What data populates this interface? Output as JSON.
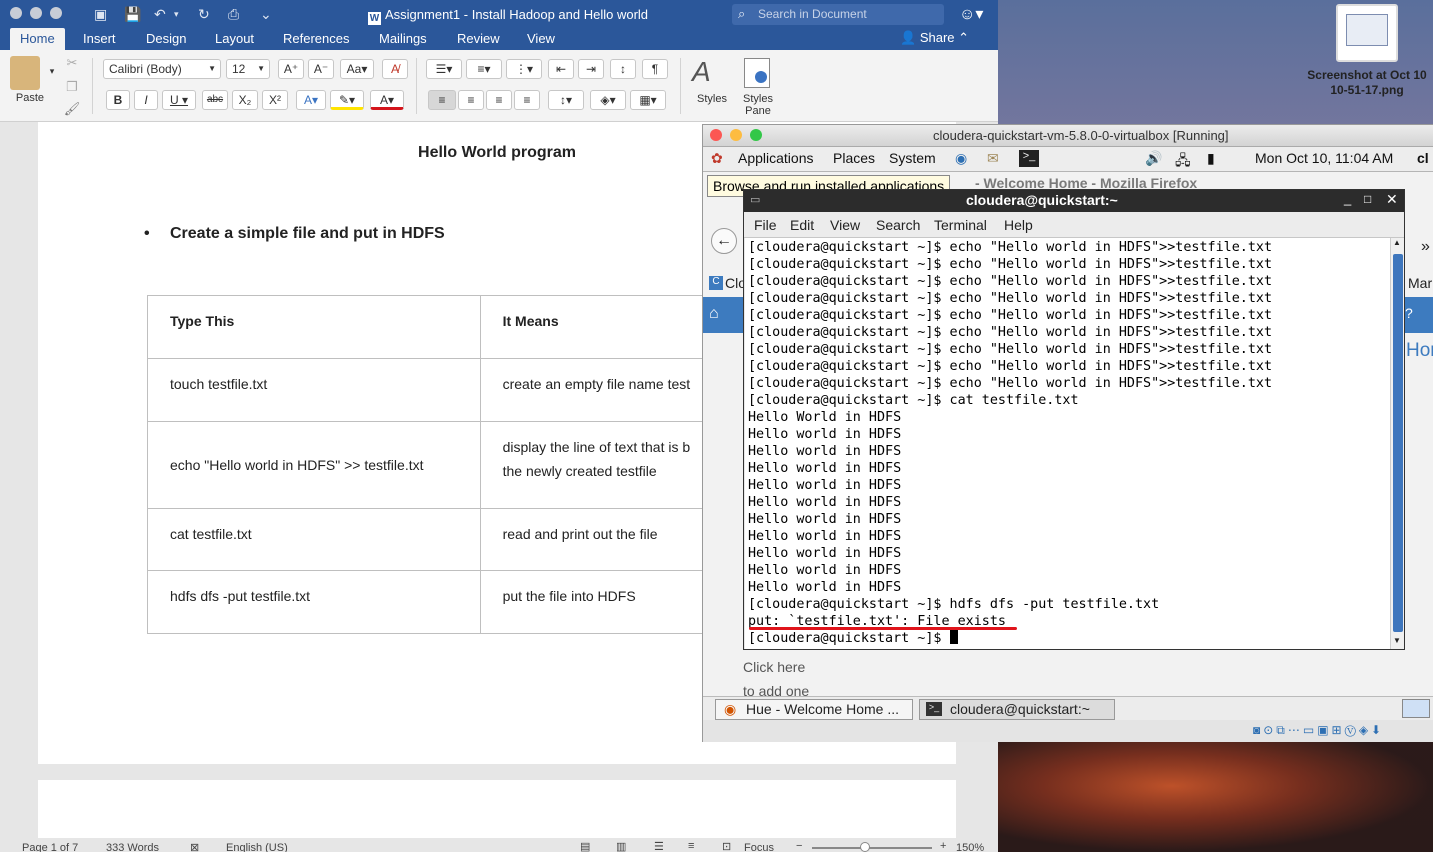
{
  "word": {
    "title": "Assignment1 - Install Hadoop and Hello world",
    "search_placeholder": "Search in Document",
    "tabs": [
      "Home",
      "Insert",
      "Design",
      "Layout",
      "References",
      "Mailings",
      "Review",
      "View"
    ],
    "share": "Share",
    "ribbon": {
      "paste": "Paste",
      "font_name": "Calibri (Body)",
      "font_size": "12",
      "styles": "Styles",
      "styles_pane": "Styles\nPane"
    },
    "doc": {
      "heading": "Hello World program",
      "bullet": "Create a simple file and put in HDFS",
      "table": {
        "headers": [
          "Type This",
          "It Means"
        ],
        "rows": [
          [
            "touch testfile.txt",
            "create an empty file name test"
          ],
          [
            "echo \"Hello world in HDFS\" >> testfile.txt",
            "display the line of text that is b\nthe newly created testfile"
          ],
          [
            "cat testfile.txt",
            "read and print out the file"
          ],
          [
            "hdfs dfs -put testfile.txt",
            "put the file into HDFS"
          ]
        ]
      }
    },
    "status": {
      "page": "Page 1 of 7",
      "words": "333 Words",
      "language": "English (US)",
      "focus": "Focus",
      "zoom": "150%"
    }
  },
  "desktop": {
    "screenshot_label": "Screenshot at Oct 10 10-51-17.png"
  },
  "vbox": {
    "title": "cloudera-quickstart-vm-5.8.0-0-virtualbox [Running]",
    "panel": {
      "applications": "Applications",
      "places": "Places",
      "system": "System",
      "clock": "Mon Oct 10, 11:04 AM",
      "user_partial": "cl"
    },
    "tooltip": "Browse and run installed applications",
    "firefox_title": "- Welcome Home - Mozilla Firefox",
    "bookmark_partial": "Clo",
    "mar_partial": "Mar",
    "hom_partial": "Hom",
    "hue_click": "Click here",
    "hue_add": "to add one",
    "taskbar": [
      "Hue - Welcome Home ...",
      "cloudera@quickstart:~"
    ]
  },
  "terminal": {
    "title": "cloudera@quickstart:~",
    "menu": [
      "File",
      "Edit",
      "View",
      "Search",
      "Terminal",
      "Help"
    ],
    "lines": [
      "[cloudera@quickstart ~]$ echo \"Hello world in HDFS\">>testfile.txt",
      "[cloudera@quickstart ~]$ echo \"Hello world in HDFS\">>testfile.txt",
      "[cloudera@quickstart ~]$ echo \"Hello world in HDFS\">>testfile.txt",
      "[cloudera@quickstart ~]$ echo \"Hello world in HDFS\">>testfile.txt",
      "[cloudera@quickstart ~]$ echo \"Hello world in HDFS\">>testfile.txt",
      "[cloudera@quickstart ~]$ echo \"Hello world in HDFS\">>testfile.txt",
      "[cloudera@quickstart ~]$ echo \"Hello world in HDFS\">>testfile.txt",
      "[cloudera@quickstart ~]$ echo \"Hello world in HDFS\">>testfile.txt",
      "[cloudera@quickstart ~]$ echo \"Hello world in HDFS\">>testfile.txt",
      "[cloudera@quickstart ~]$ cat testfile.txt",
      "Hello World in HDFS",
      "Hello world in HDFS",
      "Hello world in HDFS",
      "Hello world in HDFS",
      "Hello world in HDFS",
      "Hello world in HDFS",
      "Hello world in HDFS",
      "Hello world in HDFS",
      "Hello world in HDFS",
      "Hello world in HDFS",
      "Hello world in HDFS",
      "[cloudera@quickstart ~]$ hdfs dfs -put testfile.txt",
      "put: `testfile.txt': File exists",
      "[cloudera@quickstart ~]$ "
    ]
  },
  "colors": {
    "word_blue": "#2b579a",
    "terminal_scroll": "#3e76bd",
    "error_underline": "#e0141b"
  }
}
